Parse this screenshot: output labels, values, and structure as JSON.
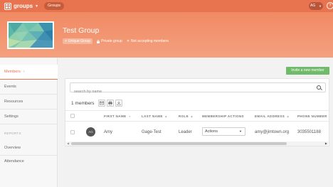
{
  "topbar": {
    "logo_text": "groups",
    "nav_label": "Groups",
    "user_initials": "AG"
  },
  "group": {
    "title": "Test Group",
    "tags": [
      {
        "label": "Unique Group"
      },
      {
        "label": "Private group"
      },
      {
        "label": "Not accepting members"
      }
    ]
  },
  "sidebar": {
    "items": [
      {
        "label": "Members"
      },
      {
        "label": "Events"
      },
      {
        "label": "Resources"
      },
      {
        "label": "Settings"
      }
    ],
    "reports_heading": "REPORTS",
    "report_items": [
      {
        "label": "Overview"
      },
      {
        "label": "Attendance"
      }
    ]
  },
  "main": {
    "invite_label": "Invite a new member",
    "search_placeholder": "search by name",
    "member_count": "1 members",
    "columns": [
      "FIRST NAME",
      "LAST NAME",
      "ROLE",
      "MEMBERSHIP ACTIONS",
      "EMAIL ADDRESS",
      "PHONE NUMBER"
    ],
    "rows": [
      {
        "initials": "AG",
        "first_name": "Amy",
        "last_name": "Gage-Test",
        "role": "Leader",
        "actions_value": "Actions",
        "email": "amy@jimtown.org",
        "phone": "3035501188"
      }
    ]
  },
  "colors": {
    "brand": "#e8744f",
    "invite": "#6fba6b"
  }
}
